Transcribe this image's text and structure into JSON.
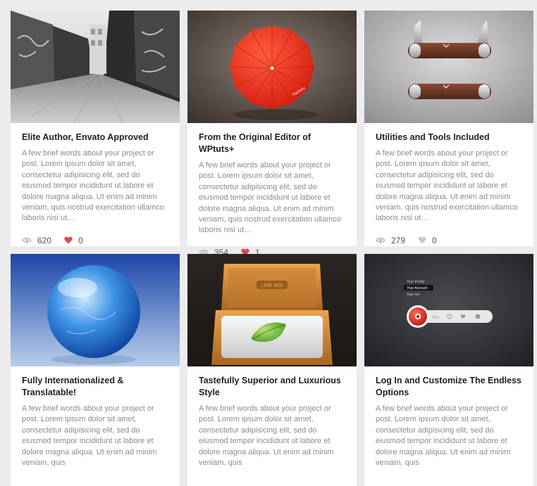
{
  "cards": [
    {
      "title": "Elite Author, Envato Approved",
      "excerpt": "A few brief words about your project or post. Lorem ipsum dolor sit amet, consectetur adipisicing elit, sed do eiusmod tempor incididunt ut labore et dolore magna aliqua. Ut enim ad minim veniam, quis nostrud exercitation ullamco laboris nisi ut…",
      "views": "620",
      "likes": "0",
      "liked": true
    },
    {
      "title": "From the Original Editor of WPtuts+",
      "excerpt": "A few brief words about your project or post. Lorem ipsum dolor sit amet, consectetur adipisicing elit, sed do eiusmod tempor incididunt ut labore et dolore magna aliqua. Ut enim ad minim veniam, quis nostrud exercitation ullamco laboris nisi ut…",
      "views": "354",
      "likes": "1",
      "liked": true,
      "image_text": "Supreme"
    },
    {
      "title": "Utilities and Tools Included",
      "excerpt": "A few brief words about your project or post. Lorem ipsum dolor sit amet, consectetur adipisicing elit, sed do eiusmod tempor incididunt ut labore et dolore magna aliqua. Ut enim ad minim veniam, quis nostrud exercitation ullamco laboris nisi ut…",
      "views": "279",
      "likes": "0",
      "liked": false
    },
    {
      "title": "Fully Internationalized & Translatable!",
      "excerpt": "A few brief words about your project or post. Lorem ipsum dolor sit amet, consectetur adipisicing elit, sed do eiusmod tempor incididunt ut labore et dolore magna aliqua. Ut enim ad minim veniam, quis"
    },
    {
      "title": "Tastefully Superior and Luxurious Style",
      "excerpt": "A few brief words about your project or post. Lorem ipsum dolor sit amet, consectetur adipisicing elit, sed do eiusmod tempor incididunt ut labore et dolore magna aliqua. Ut enim ad minim veniam, quis",
      "image_text": "LIVE WIX"
    },
    {
      "title": "Log In and Customize The Endless Options",
      "excerpt": "A few brief words about your project or post. Lorem ipsum dolor sit amet, consectetur adipisicing elit, sed do eiusmod tempor incididunt ut labore et dolore magna aliqua. Ut enim ad minim veniam, quis",
      "image_menu": [
        "Your Profile",
        "Your Account",
        "Sign out"
      ],
      "image_bar_label": "You"
    }
  ],
  "colors": {
    "heart_active": "#e0484a",
    "heart_inactive": "#c9c9c9",
    "eye_icon": "#b3b3b3"
  },
  "icons": {
    "views": "eye-icon",
    "likes": "heart-icon"
  }
}
